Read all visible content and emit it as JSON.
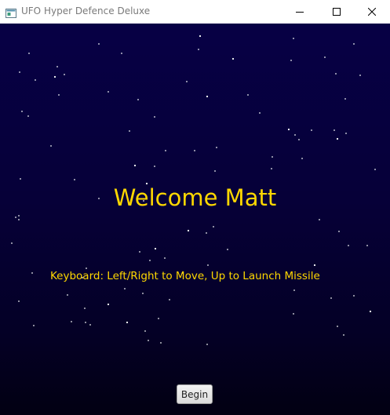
{
  "window": {
    "title": "UFO Hyper Defence Deluxe",
    "icon": "app-window-icon",
    "controls": {
      "minimize_icon": "minimize-icon",
      "maximize_icon": "maximize-icon",
      "close_icon": "close-icon"
    }
  },
  "game": {
    "welcome_text": "Welcome Matt",
    "keyboard_text": "Keyboard:  Left/Right to Move, Up to Launch Missile",
    "begin_label": "Begin"
  },
  "colors": {
    "background_top": "#070045",
    "background_bottom": "#020012",
    "text_accent": "#ffd800",
    "star": "#ffffff"
  }
}
